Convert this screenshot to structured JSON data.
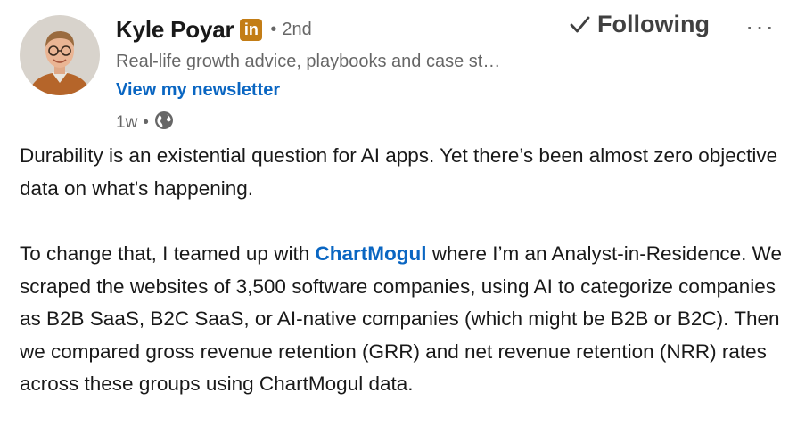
{
  "post": {
    "author": {
      "name": "Kyle Poyar",
      "badge": "in",
      "separator": "•",
      "degree": "2nd",
      "headline": "Real-life growth advice, playbooks and case st…",
      "newsletter_link": "View my newsletter"
    },
    "follow_label": "Following",
    "more_label": "···",
    "time": "1w",
    "time_separator": "•",
    "visibility_icon": "globe-icon",
    "paragraph1": "Durability is an existential question for AI apps. Yet there’s been almost zero objective data on what's happening.",
    "paragraph2_before": "To change that, I teamed up with ",
    "paragraph2_mention": "ChartMogul",
    "paragraph2_after": " where I’m an Analyst-in-Residence. We scraped the websites of 3,500 software companies, using AI to categorize companies as B2B SaaS, B2C SaaS, or AI-native companies (which might be B2B or B2C). Then we compared gross revenue retention (GRR) and net revenue retention (NRR) rates across these groups using ChartMogul data."
  },
  "colors": {
    "link": "#0a66c2",
    "badge": "#C37D16"
  }
}
